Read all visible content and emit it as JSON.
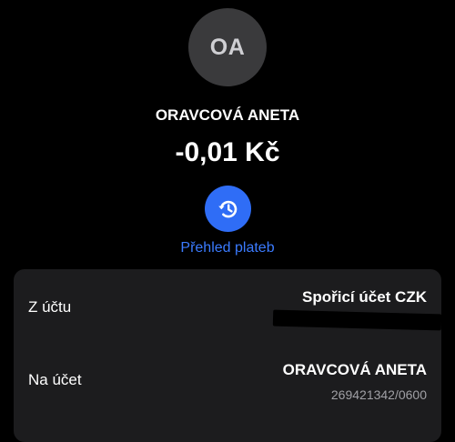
{
  "header": {
    "avatar_initials": "OA",
    "payee_name": "ORAVCOVÁ ANETA",
    "amount": "-0,01 Kč",
    "history_label": "Přehled plateb",
    "history_icon": "history-clock-icon"
  },
  "details": {
    "from_account": {
      "label": "Z účtu",
      "value": "Spořicí účet CZK"
    },
    "to_account": {
      "label": "Na účet",
      "value": "ORAVCOVÁ ANETA",
      "account_number": "269421342/0600"
    }
  },
  "colors": {
    "background": "#000000",
    "card": "#1c1c1e",
    "avatar": "#3a3a3c",
    "accent": "#2f6df6",
    "link": "#3b7bff",
    "secondary_text": "#a0a0a5"
  }
}
